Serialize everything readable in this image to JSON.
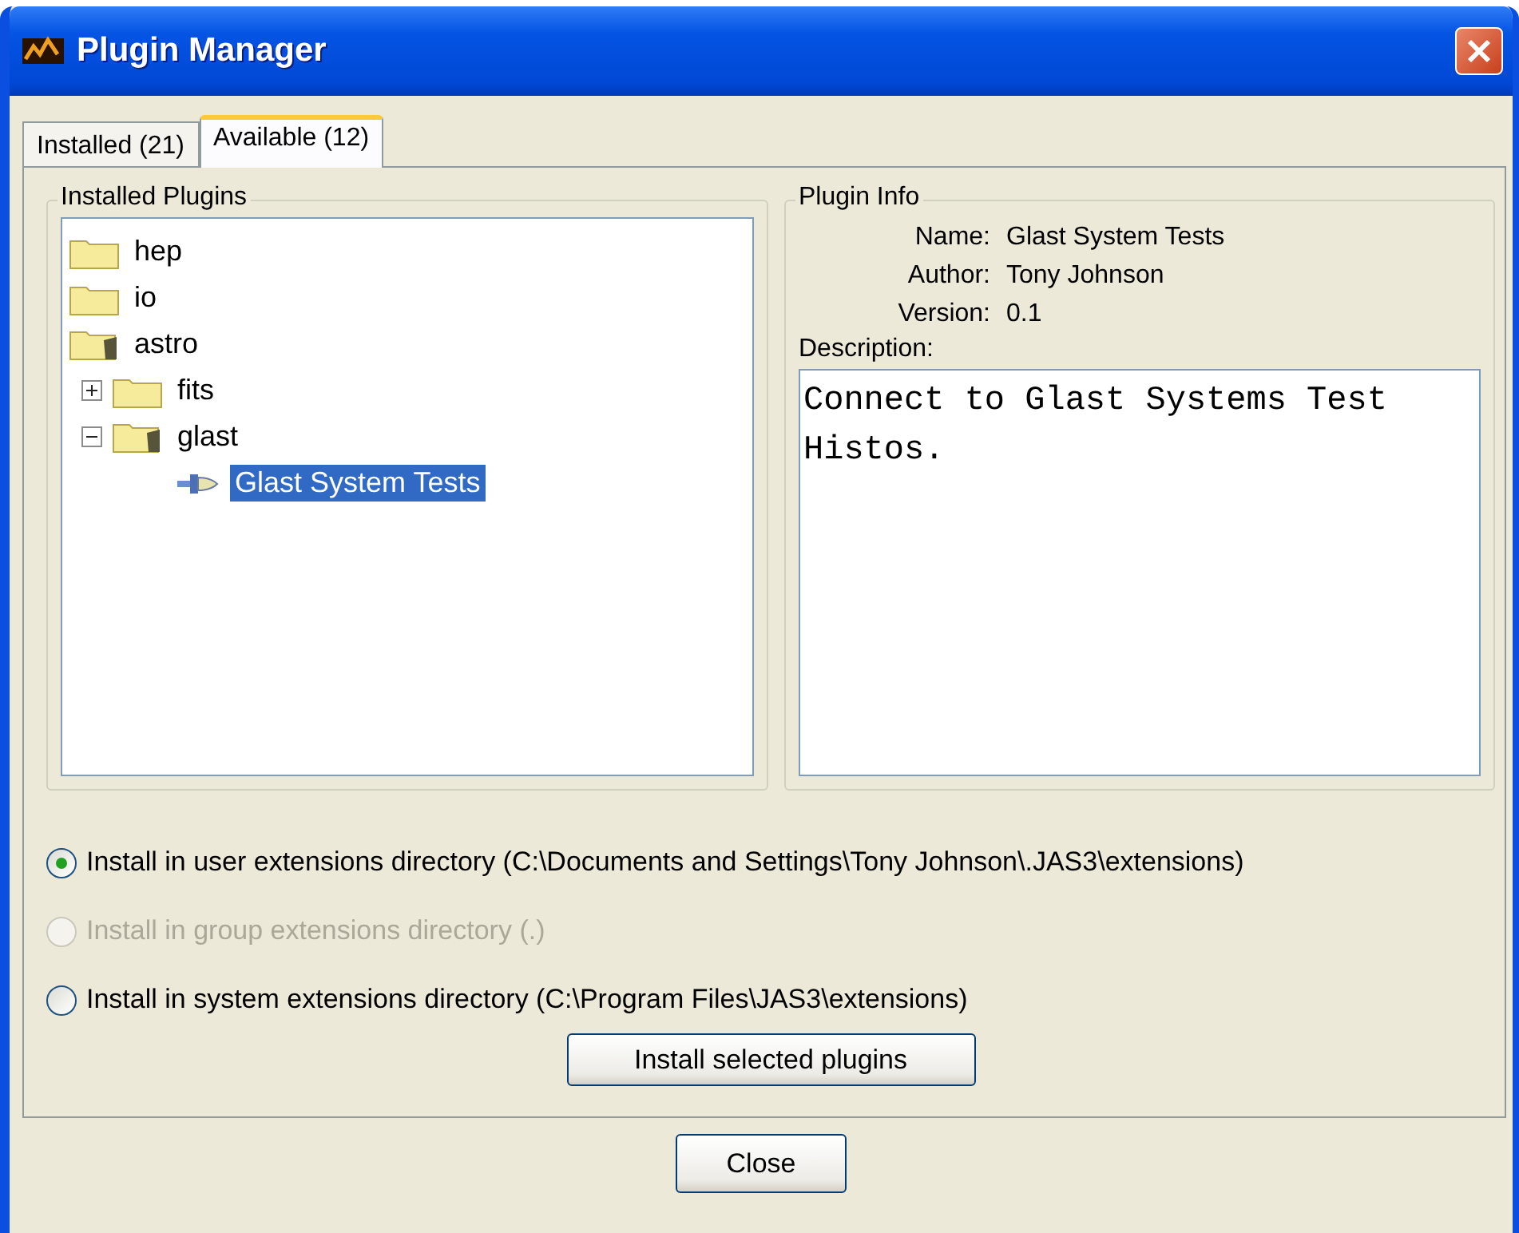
{
  "window": {
    "title": "Plugin Manager"
  },
  "tabs": [
    {
      "label": "Installed (21)",
      "selected": false
    },
    {
      "label": "Available (12)",
      "selected": true
    }
  ],
  "tree_group": {
    "title": "Installed Plugins",
    "items": [
      {
        "label": "hep",
        "kind": "folder",
        "expanded": false,
        "selected": false
      },
      {
        "label": "io",
        "kind": "folder",
        "expanded": false,
        "selected": false
      },
      {
        "label": "astro",
        "kind": "folder",
        "expanded": true,
        "selected": false,
        "children": [
          {
            "label": "fits",
            "kind": "folder",
            "expanded": false,
            "selected": false
          },
          {
            "label": "glast",
            "kind": "folder",
            "expanded": true,
            "selected": false,
            "children": [
              {
                "label": "Glast System Tests",
                "kind": "plugin",
                "selected": true
              }
            ]
          }
        ]
      }
    ]
  },
  "info_group": {
    "title": "Plugin Info",
    "fields": [
      {
        "label": "Name:",
        "value": "Glast System Tests"
      },
      {
        "label": "Author:",
        "value": "Tony Johnson"
      },
      {
        "label": "Version:",
        "value": "0.1"
      }
    ],
    "description_label": "Description:",
    "description": "Connect to Glast Systems Test Histos."
  },
  "install_options": [
    {
      "label": "Install in user extensions directory (C:\\Documents and Settings\\Tony Johnson\\.JAS3\\extensions)",
      "selected": true,
      "disabled": false
    },
    {
      "label": "Install in group extensions directory (.)",
      "selected": false,
      "disabled": true
    },
    {
      "label": "Install in system extensions directory (C:\\Program Files\\JAS3\\extensions)",
      "selected": false,
      "disabled": false
    }
  ],
  "install_button": "Install selected plugins",
  "close_button": "Close"
}
